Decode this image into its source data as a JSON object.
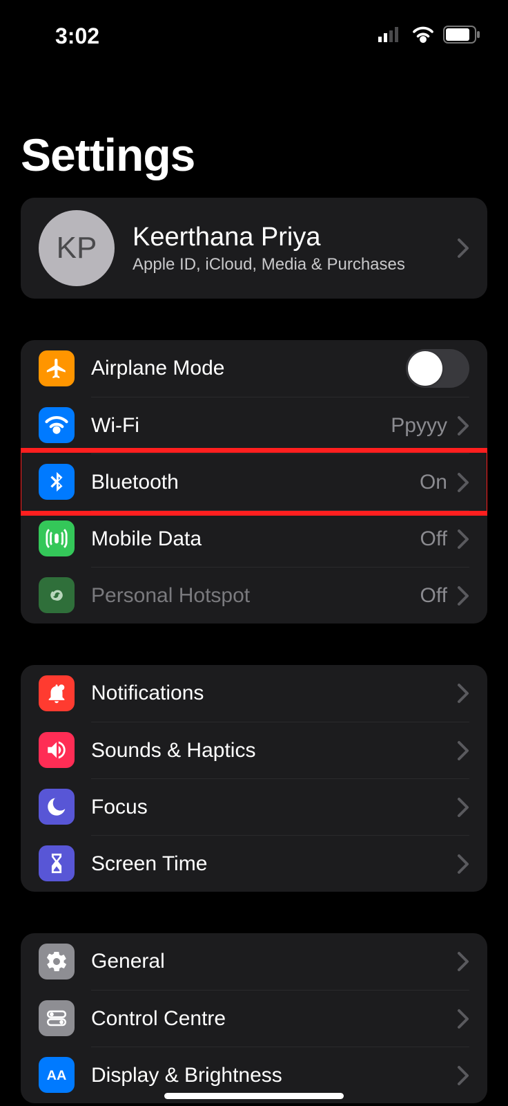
{
  "status": {
    "time": "3:02"
  },
  "title": "Settings",
  "profile": {
    "initials": "KP",
    "name": "Keerthana Priya",
    "subtitle": "Apple ID, iCloud, Media & Purchases"
  },
  "group1": {
    "airplane": {
      "label": "Airplane Mode",
      "on": false
    },
    "wifi": {
      "label": "Wi-Fi",
      "value": "Ppyyy"
    },
    "bluetooth": {
      "label": "Bluetooth",
      "value": "On"
    },
    "mobile": {
      "label": "Mobile Data",
      "value": "Off"
    },
    "hotspot": {
      "label": "Personal Hotspot",
      "value": "Off"
    }
  },
  "group2": {
    "notifications": {
      "label": "Notifications"
    },
    "sounds": {
      "label": "Sounds & Haptics"
    },
    "focus": {
      "label": "Focus"
    },
    "screentime": {
      "label": "Screen Time"
    }
  },
  "group3": {
    "general": {
      "label": "General"
    },
    "control": {
      "label": "Control Centre"
    },
    "display": {
      "label": "Display & Brightness"
    }
  }
}
